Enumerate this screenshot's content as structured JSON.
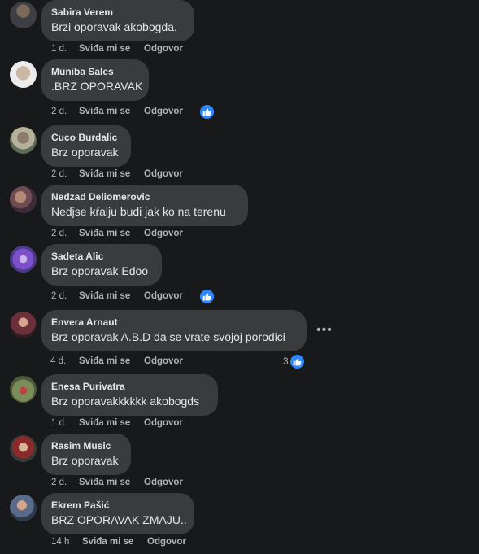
{
  "comments": [
    {
      "author": "Sabira Verem",
      "text": "Brzi oporavak akobogda.",
      "time": "1 d.",
      "like_label": "Sviđa mi se",
      "reply_label": "Odgovor",
      "reactions": null
    },
    {
      "author": "Muniba Sales",
      "text": ".BRZ OPORAVAK",
      "time": "2 d.",
      "like_label": "Sviđa mi se",
      "reply_label": "Odgovor",
      "reactions": {
        "icon": "like-icon",
        "count": ""
      }
    },
    {
      "author": "Cuco Burdalic",
      "text": "Brz oporavak",
      "time": "2 d.",
      "like_label": "Sviđa mi se",
      "reply_label": "Odgovor",
      "reactions": null
    },
    {
      "author": "Nedzad Deliomerovic",
      "text": "Nedjse kŕalju budi jak ko na terenu",
      "time": "2 d.",
      "like_label": "Sviđa mi se",
      "reply_label": "Odgovor",
      "reactions": null
    },
    {
      "author": "Sadeta Alic",
      "text": "Brz oporavak Edoo",
      "time": "2 d.",
      "like_label": "Sviđa mi se",
      "reply_label": "Odgovor",
      "reactions": {
        "icon": "like-icon",
        "count": ""
      }
    },
    {
      "author": "Envera Arnaut",
      "text": "Brz oporavak A.B.D da se vrate svojoj porodici",
      "time": "4 d.",
      "like_label": "Sviđa mi se",
      "reply_label": "Odgovor",
      "reactions": {
        "icon": "like-icon",
        "count": "3"
      },
      "menu_icon": "more-options-icon"
    },
    {
      "author": "Enesa Purivatra",
      "text": "Brz oporavakkkkkk akobogds",
      "time": "1 d.",
      "like_label": "Sviđa mi se",
      "reply_label": "Odgovor",
      "reactions": null
    },
    {
      "author": "Rasim Music",
      "text": "Brz oporavak",
      "time": "2 d.",
      "like_label": "Sviđa mi se",
      "reply_label": "Odgovor",
      "reactions": null
    },
    {
      "author": "Ekrem Pašić",
      "text": "BRZ OPORAVAK ZMAJU..",
      "time": "14 h",
      "like_label": "Sviđa mi se",
      "reply_label": "Odgovor",
      "reactions": null
    }
  ],
  "colors": {
    "background": "#18191a",
    "bubble": "#3a3b3c",
    "text": "#e4e6eb",
    "muted": "#b0b3b8",
    "like_blue": "#2d88ff"
  }
}
